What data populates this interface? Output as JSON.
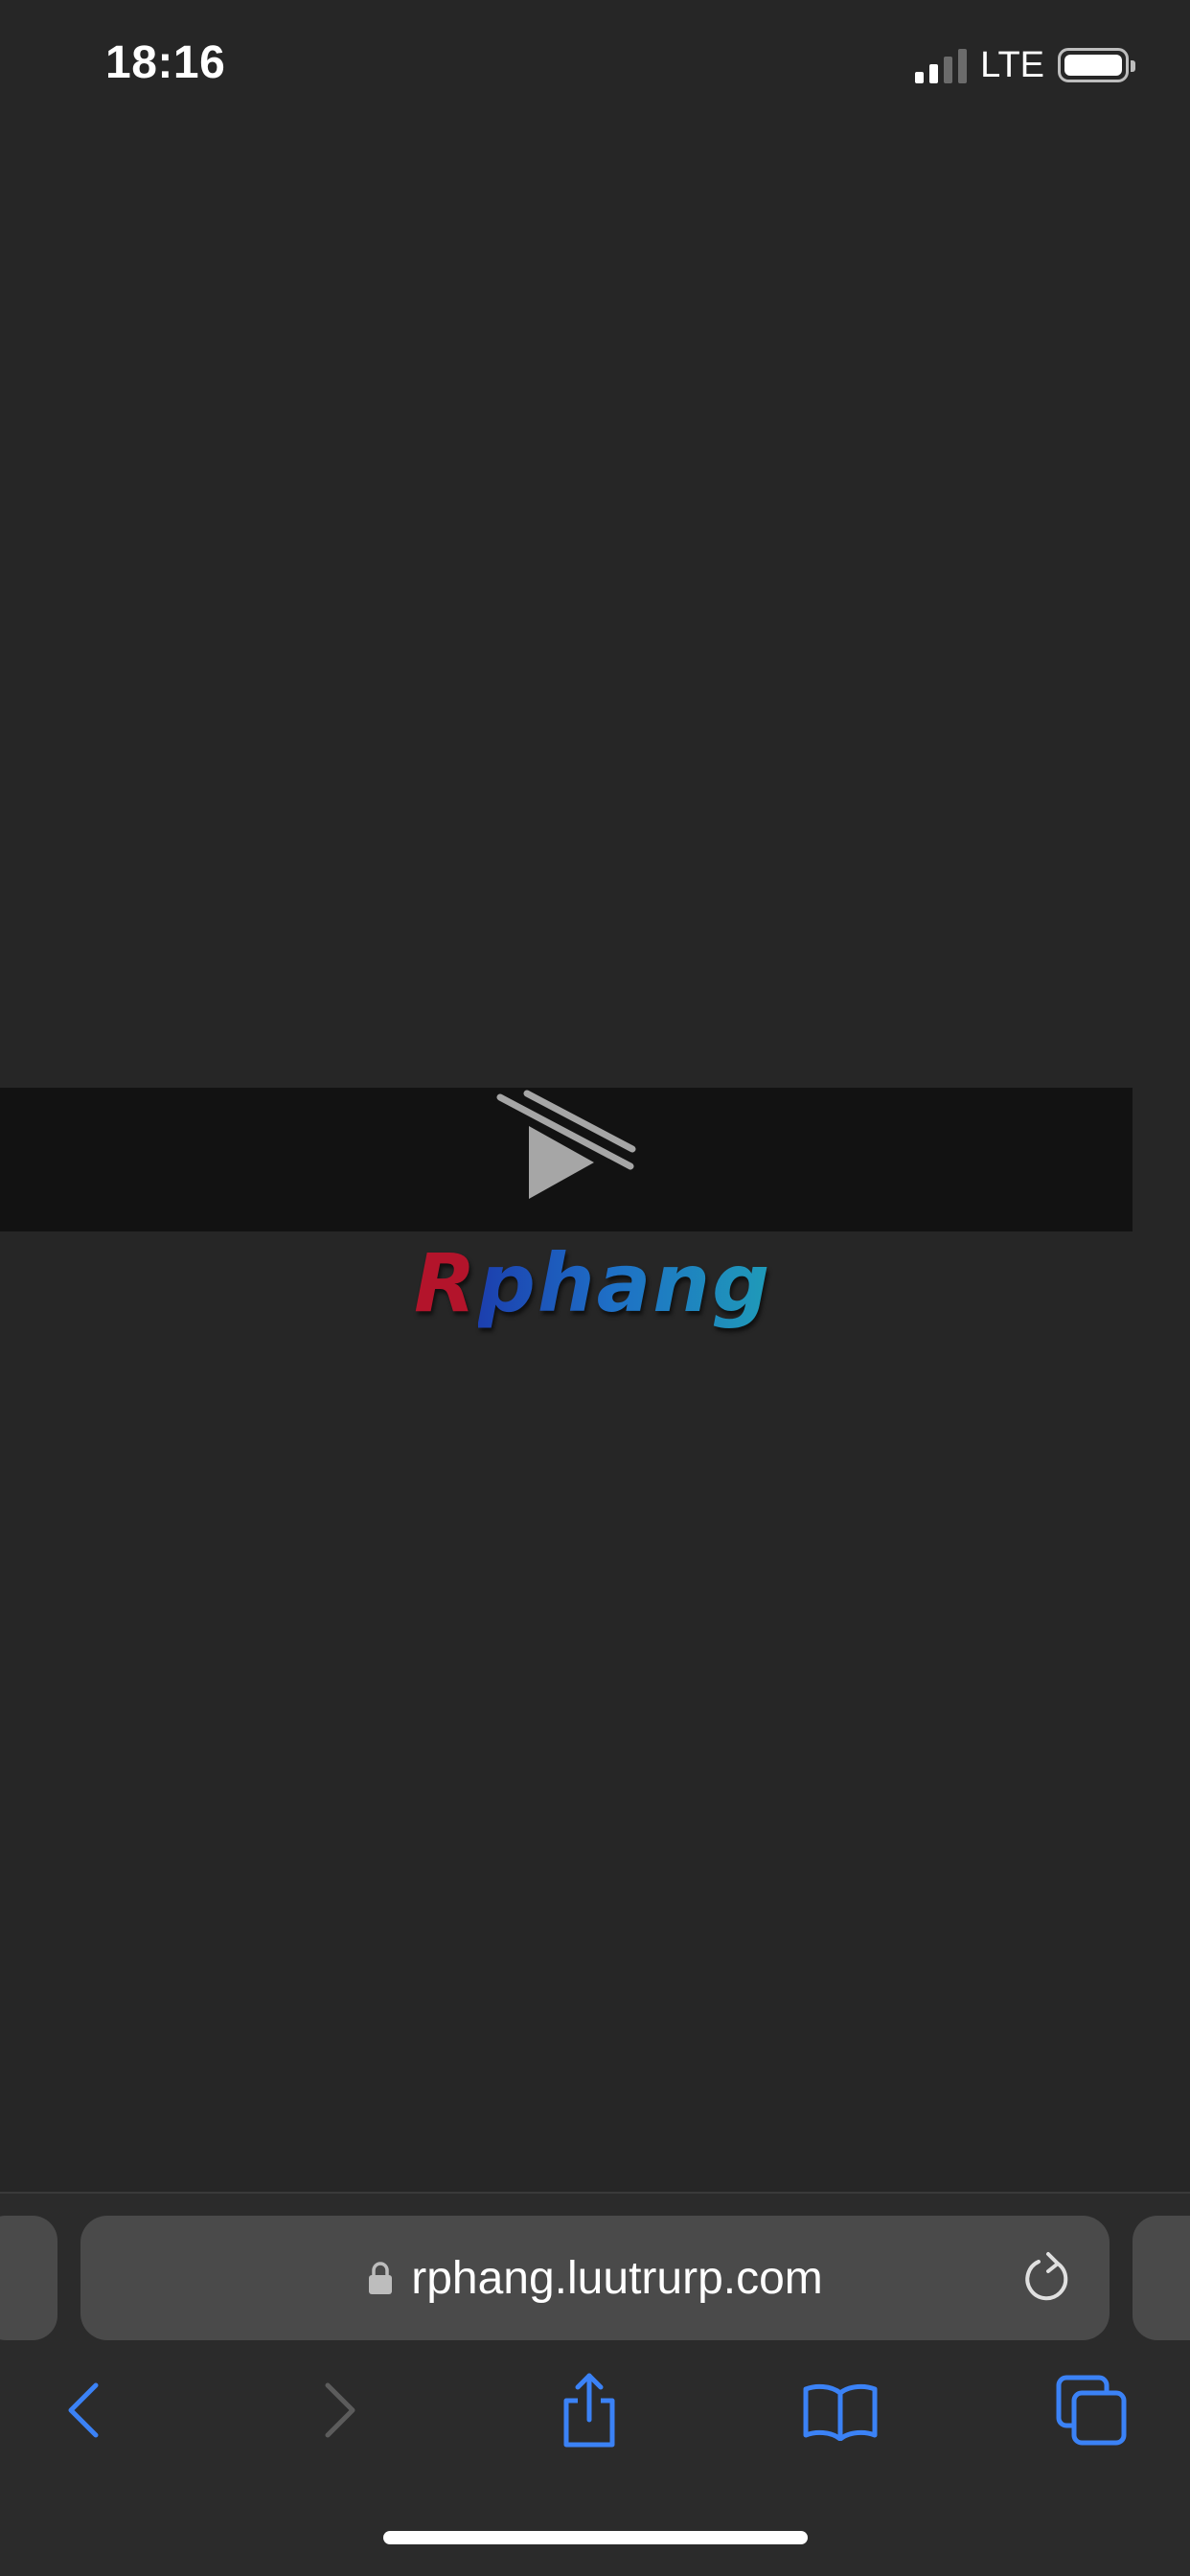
{
  "status_bar": {
    "time": "18:16",
    "network": "LTE",
    "signal_bars_active": 2,
    "signal_bars_total": 4,
    "battery_level": 1.0
  },
  "video": {
    "state_icon": "play-disabled-icon"
  },
  "logo": {
    "text_first": "R",
    "text_rest": "phang",
    "colors": {
      "first": "#b3142b",
      "rest_start": "#1c3fae",
      "rest_end": "#1f9bb8"
    }
  },
  "toolbar": {
    "url": "rphang.luutrurp.com",
    "accent_color": "#3b82f6",
    "icons": {
      "back": "chevron-left-icon",
      "forward": "chevron-right-icon",
      "share": "share-icon",
      "bookmarks": "book-icon",
      "tabs": "tabs-icon",
      "lock": "lock-icon",
      "reload": "reload-icon"
    }
  },
  "colors": {
    "background": "#262626",
    "video_band": "#121212",
    "toolbar": "#2b2b2b",
    "address_bar": "#4a4a4a"
  }
}
